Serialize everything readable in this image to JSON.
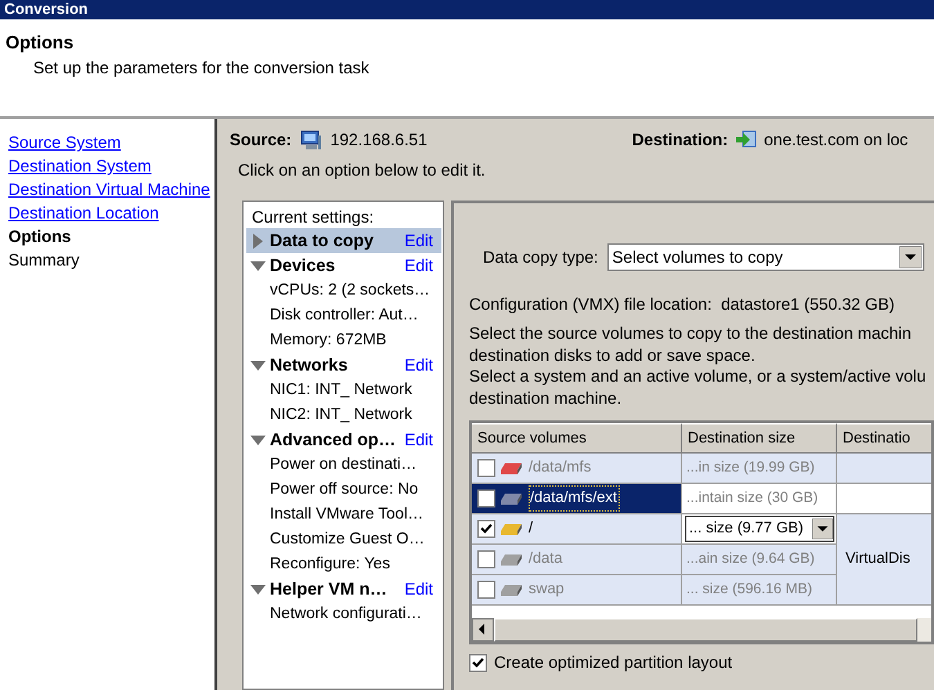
{
  "window": {
    "title": "Conversion"
  },
  "header": {
    "title": "Options",
    "subtitle": "Set up the parameters for the conversion task"
  },
  "nav": [
    {
      "label": "Source System",
      "selected": false,
      "link": true
    },
    {
      "label": "Destination System",
      "selected": false,
      "link": true
    },
    {
      "label": "Destination Virtual Machine",
      "selected": false,
      "link": true
    },
    {
      "label": "Destination Location",
      "selected": false,
      "link": true
    },
    {
      "label": "Options",
      "selected": true,
      "link": false
    },
    {
      "label": "Summary",
      "selected": false,
      "link": false
    }
  ],
  "source": {
    "label": "Source:",
    "value": "192.168.6.51"
  },
  "destination": {
    "label": "Destination:",
    "value": "one.test.com on loc"
  },
  "instruction": "Click on an option below to edit it.",
  "settings": {
    "title": "Current settings:",
    "groups": [
      {
        "label": "Data to copy",
        "edit": "Edit",
        "expanded": false,
        "selected": true
      },
      {
        "label": "Devices",
        "edit": "Edit",
        "expanded": true,
        "selected": false,
        "children": [
          "vCPUs: 2 (2 sockets…",
          "Disk controller: Aut…",
          "Memory: 672MB"
        ]
      },
      {
        "label": "Networks",
        "edit": "Edit",
        "expanded": true,
        "selected": false,
        "children": [
          "NIC1: INT_ Network",
          "NIC2: INT_ Network"
        ]
      },
      {
        "label": "Advanced op…",
        "edit": "Edit",
        "expanded": true,
        "selected": false,
        "children": [
          "Power on destinati…",
          "Power off source: No",
          "Install VMware Tool…",
          "Customize Guest O…",
          "Reconfigure: Yes"
        ]
      },
      {
        "label": "Helper VM n…",
        "edit": "Edit",
        "expanded": true,
        "selected": false,
        "children": [
          "Network configurati…"
        ]
      }
    ]
  },
  "copy_type": {
    "label": "Data copy type:",
    "value": "Select volumes to copy"
  },
  "config_location": "Configuration (VMX) file location:  datastore1 (550.32 GB)",
  "help": [
    "Select the source volumes to copy to the destination machin",
    "destination disks to add or save space.",
    "Select a system and an active volume, or a system/active volu",
    "destination machine."
  ],
  "table": {
    "columns": [
      "Source volumes",
      "Destination size",
      "Destinatio"
    ],
    "rows": [
      {
        "name": "/data/mfs",
        "size": "...in size (19.99 GB)",
        "kind": "text",
        "checked": false,
        "selected": false,
        "color": "#e04848"
      },
      {
        "name": "/data/mfs/ext",
        "size": "...intain size (30 GB)",
        "kind": "text",
        "checked": false,
        "selected": true,
        "color": "#8088a8"
      },
      {
        "name": "/",
        "size": "... size (9.77 GB)",
        "kind": "dropdown",
        "checked": true,
        "selected": false,
        "color": "#e8b830",
        "destination": "VirtualDis"
      },
      {
        "name": "/data",
        "size": "...ain size (9.64 GB)",
        "kind": "text",
        "checked": false,
        "selected": false,
        "color": "#a0a0a0"
      },
      {
        "name": "swap",
        "size": "... size (596.16 MB)",
        "kind": "text",
        "checked": false,
        "selected": false,
        "color": "#a0a0a0"
      }
    ]
  },
  "optimize": {
    "label": "Create optimized partition layout",
    "checked": true
  }
}
